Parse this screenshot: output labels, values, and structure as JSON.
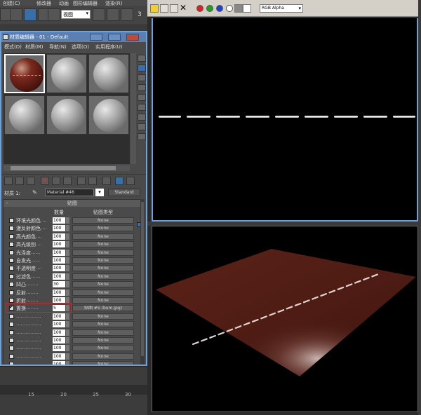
{
  "topbar": {
    "menus": [
      "创建(C)",
      "修改器",
      "动画",
      "图形编辑器",
      "渲染(R)"
    ]
  },
  "toolbar": {
    "view_label": "视图",
    "extra": "3"
  },
  "material_editor": {
    "title": "材质编辑器 - 01 - Default",
    "menus": [
      "模式(D)",
      "材质(M)",
      "导航(N)",
      "选项(O)",
      "实用程序(U)"
    ],
    "slot_count": 6,
    "active_slot": 0,
    "material_label": "材质 1:",
    "material_name": "Material #46",
    "material_type": "Standard",
    "maps_title": "贴图",
    "col_amount": "数量",
    "col_map_type": "贴图类型",
    "rows": [
      {
        "name": "环境光颜色",
        "dots": "....",
        "amount": "100",
        "map": "None",
        "checked": false
      },
      {
        "name": "漫反射颜色",
        "dots": "....",
        "amount": "100",
        "map": "None",
        "checked": false
      },
      {
        "name": "高光颜色",
        "dots": "....",
        "amount": "100",
        "map": "None",
        "checked": false
      },
      {
        "name": "高光级别",
        "dots": "....",
        "amount": "100",
        "map": "None",
        "checked": false
      },
      {
        "name": "光泽度",
        "dots": "......",
        "amount": "100",
        "map": "None",
        "checked": false
      },
      {
        "name": "自发光",
        "dots": "......",
        "amount": "100",
        "map": "None",
        "checked": false
      },
      {
        "name": "不透明度",
        "dots": "....",
        "amount": "100",
        "map": "None",
        "checked": false
      },
      {
        "name": "过滤色",
        "dots": "......",
        "amount": "100",
        "map": "None",
        "checked": false
      },
      {
        "name": "凹凸",
        "dots": "........",
        "amount": "30",
        "map": "None",
        "checked": false
      },
      {
        "name": "反射",
        "dots": "........",
        "amount": "100",
        "map": "None",
        "checked": false
      },
      {
        "name": "折射",
        "dots": "........",
        "amount": "100",
        "map": "None",
        "checked": false
      },
      {
        "name": "置换",
        "dots": "........",
        "amount": "5",
        "map": "贴图 #5 (bum.jpg)",
        "checked": true
      },
      {
        "name": "",
        "dots": "................",
        "amount": "100",
        "map": "None",
        "checked": false
      },
      {
        "name": "",
        "dots": "................",
        "amount": "100",
        "map": "None",
        "checked": false
      },
      {
        "name": "",
        "dots": "................",
        "amount": "100",
        "map": "None",
        "checked": false
      },
      {
        "name": "",
        "dots": "................",
        "amount": "100",
        "map": "None",
        "checked": false
      },
      {
        "name": "",
        "dots": "................",
        "amount": "100",
        "map": "None",
        "checked": false
      },
      {
        "name": "",
        "dots": "................",
        "amount": "100",
        "map": "None",
        "checked": false
      },
      {
        "name": "",
        "dots": "................",
        "amount": "100",
        "map": "None",
        "checked": false
      },
      {
        "name": "",
        "dots": "................",
        "amount": "100",
        "map": "None",
        "checked": false
      },
      {
        "name": "",
        "dots": "................",
        "amount": "100",
        "map": "None",
        "checked": false
      }
    ]
  },
  "timeline": {
    "ticks": [
      "15",
      "20",
      "25",
      "30"
    ]
  },
  "render_frame": {
    "channel": "RGB Alpha",
    "colors": [
      "#e02020",
      "#20a020",
      "#2040d0"
    ]
  }
}
